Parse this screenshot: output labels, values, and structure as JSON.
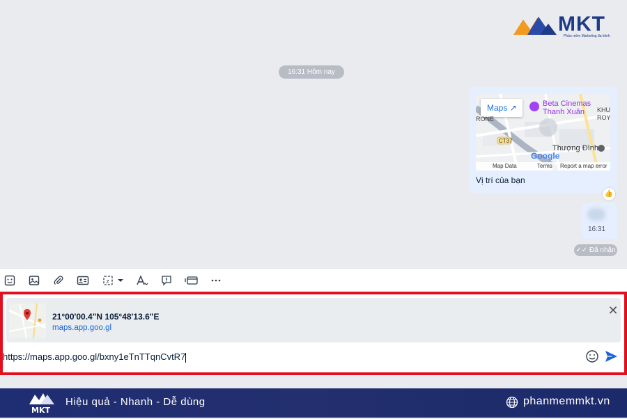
{
  "logo": {
    "brand": "MKT",
    "tagline": "Phần mềm Marketing đa kênh",
    "colors": {
      "orange": "#f29a1f",
      "blue": "#1e3b8a"
    }
  },
  "chat": {
    "time_separator": "16:31 Hôm nay",
    "map_card": {
      "maps_button": "Maps",
      "caption": "Vị trí của bạn",
      "map_labels": {
        "poi": "Beta Cinemas",
        "poi_line2": "Thanh Xuân",
        "khu": "KHU",
        "roy": "ROY",
        "rone": "RONE",
        "road": "CT37",
        "area": "Thượng Đình",
        "google": "Google",
        "map_data": "Map Data",
        "terms": "Terms",
        "report": "Report a map error"
      }
    },
    "small_message_time": "16:31",
    "status": "Đã nhận"
  },
  "toolbar": {
    "icons": [
      "sticker-icon",
      "image-icon",
      "attachment-icon",
      "contact-card-icon",
      "screenshot-icon",
      "format-text-icon",
      "quick-message-icon",
      "card-icon",
      "more-icon"
    ]
  },
  "composer": {
    "preview": {
      "coordinates": "21°00'00.4\"N 105°48'13.6\"E",
      "link": "maps.app.goo.gl"
    },
    "input_value": "https://maps.app.goo.gl/bxny1eTnTTqnCvtR7",
    "highlight_color": "#e10f1f"
  },
  "footer": {
    "slogan": "Hiệu quả - Nhanh - Dễ dùng",
    "website": "phanmemmkt.vn",
    "logo_text": "MKT",
    "background": "#1f2d73"
  }
}
